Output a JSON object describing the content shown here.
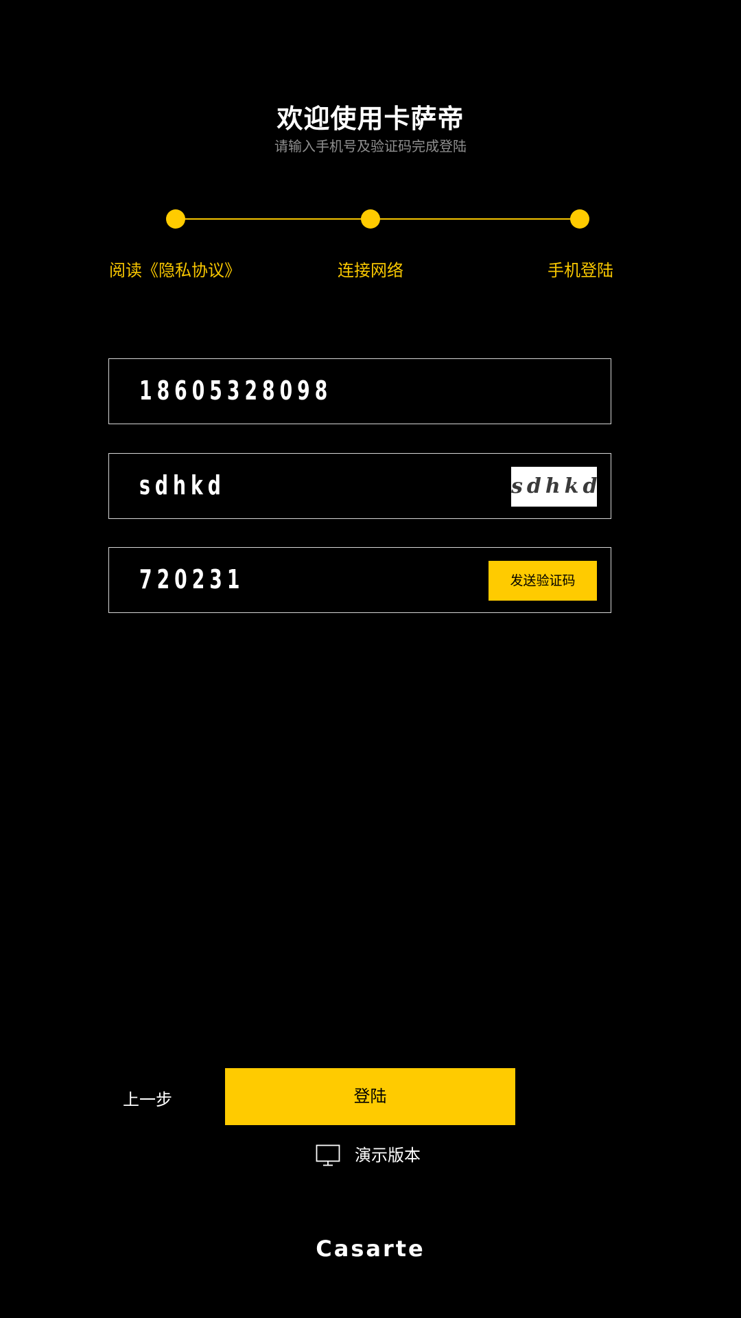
{
  "header": {
    "title": "欢迎使用卡萨帝",
    "subtitle": "请输入手机号及验证码完成登陆"
  },
  "steps": [
    {
      "label": "阅读《隐私协议》"
    },
    {
      "label": "连接网络"
    },
    {
      "label": "手机登陆"
    }
  ],
  "form": {
    "phone_value": "18605328098",
    "captcha_value": "sdhkd",
    "captcha_image_text": "sdhkd",
    "sms_code_value": "720231",
    "send_code_label": "发送验证码"
  },
  "actions": {
    "back_label": "上一步",
    "login_label": "登陆",
    "demo_label": "演示版本",
    "demo_icon": "monitor-icon"
  },
  "brand": {
    "logo_text": "Casarte"
  },
  "colors": {
    "accent": "#ffcb00",
    "background": "#000000",
    "border": "#d8d8d8",
    "subtitle": "#8f8f8f"
  }
}
